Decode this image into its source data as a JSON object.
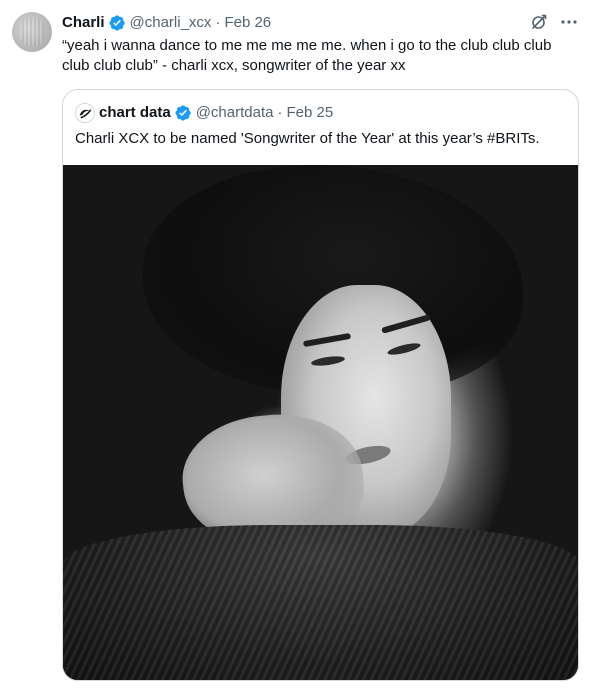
{
  "tweet": {
    "author": {
      "display_name": "Charli",
      "handle": "@charli_xcx",
      "verified": true
    },
    "separator": "·",
    "date": "Feb 26",
    "text": "“yeah i wanna dance to me me me me me. when i go to the club club club club club club” - charli xcx, songwriter of the year xx",
    "actions": {
      "grok_icon": "grok-icon",
      "more_icon": "more-icon"
    },
    "quoted": {
      "author": {
        "display_name": "chart data",
        "handle": "@chartdata",
        "verified": true
      },
      "separator": "·",
      "date": "Feb 25",
      "text": "Charli XCX to be named 'Songwriter of the Year' at this year’s #BRITs."
    }
  },
  "colors": {
    "text_primary": "#0f1419",
    "text_secondary": "#536471",
    "verified_blue": "#1d9bf0",
    "border": "#cfd9de"
  }
}
